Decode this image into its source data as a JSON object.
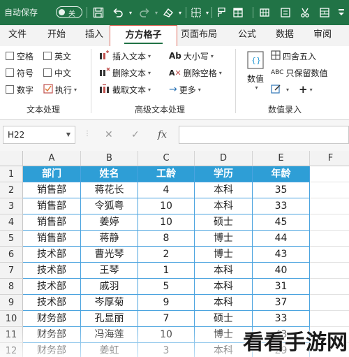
{
  "titlebar": {
    "autosave_label": "自动保存",
    "autosave_state": "关",
    "bg_color": "#217346",
    "icons": [
      "save-icon",
      "undo-icon",
      "redo-icon",
      "eraser-icon",
      "border-grid-icon",
      "format-painter-icon",
      "table-icon",
      "grid-view-icon",
      "scissors-icon",
      "merge-cells-icon"
    ]
  },
  "tabs": [
    {
      "label": "文件"
    },
    {
      "label": "开始"
    },
    {
      "label": "插入"
    },
    {
      "label": "方方格子",
      "active": true
    },
    {
      "label": "页面布局"
    },
    {
      "label": "公式"
    },
    {
      "label": "数据"
    },
    {
      "label": "审阅"
    }
  ],
  "ribbon": {
    "text_processing": {
      "checks": [
        [
          "空格",
          "英文"
        ],
        [
          "符号",
          "中文"
        ],
        [
          "数字",
          "执行"
        ]
      ],
      "group_label": "文本处理"
    },
    "advanced_text": {
      "insert_text": "插入文本",
      "delete_text": "删除文本",
      "extract_text": "截取文本",
      "case": "大小写",
      "delete_spaces": "删除空格",
      "more": "更多",
      "group_label": "高级文本处理"
    },
    "numeric": {
      "big_button": "数值",
      "round": "四舍五入",
      "keep_value": "只保留数值",
      "group_label": "数值录入"
    }
  },
  "formula_bar": {
    "name_box": "H22",
    "cancel": "✕",
    "confirm": "✓",
    "fx": "fx",
    "value": ""
  },
  "grid": {
    "columns": [
      "A",
      "B",
      "C",
      "D",
      "E",
      "F"
    ],
    "header": {
      "row": "1",
      "cells": [
        "部门",
        "姓名",
        "工龄",
        "学历",
        "年龄"
      ]
    },
    "rows": [
      {
        "row": "2",
        "cells": [
          "销售部",
          "蒋花长",
          "4",
          "本科",
          "35"
        ]
      },
      {
        "row": "3",
        "cells": [
          "销售部",
          "令狐粤",
          "10",
          "本科",
          "33"
        ]
      },
      {
        "row": "4",
        "cells": [
          "销售部",
          "姜婷",
          "10",
          "硕士",
          "45"
        ]
      },
      {
        "row": "5",
        "cells": [
          "销售部",
          "蒋静",
          "8",
          "博士",
          "44"
        ]
      },
      {
        "row": "6",
        "cells": [
          "技术部",
          "曹光琴",
          "2",
          "博士",
          "43"
        ]
      },
      {
        "row": "7",
        "cells": [
          "技术部",
          "王琴",
          "1",
          "本科",
          "40"
        ]
      },
      {
        "row": "8",
        "cells": [
          "技术部",
          "戚羽",
          "5",
          "本科",
          "31"
        ]
      },
      {
        "row": "9",
        "cells": [
          "技术部",
          "岑厚菊",
          "9",
          "本科",
          "37"
        ]
      },
      {
        "row": "10",
        "cells": [
          "财务部",
          "孔显丽",
          "7",
          "硕士",
          "33"
        ]
      },
      {
        "row": "11",
        "cells": [
          "财务部",
          "冯海莲",
          "10",
          "博士",
          "43"
        ]
      },
      {
        "row": "12",
        "cells": [
          "财务部",
          "姜虹",
          "3",
          "本科",
          "29"
        ]
      }
    ],
    "header_color": "#2e9ed6"
  },
  "watermark": "看看手游网"
}
